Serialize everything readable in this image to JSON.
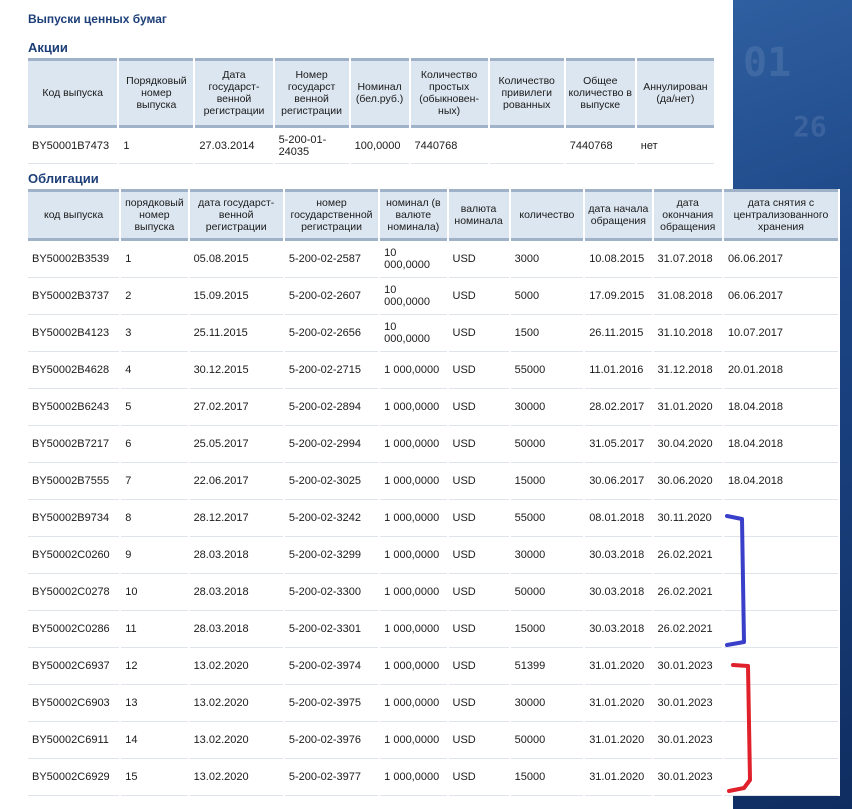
{
  "page": {
    "title": "Выпуски ценных бумаг"
  },
  "stocks": {
    "heading": "Акции",
    "headers": [
      "Код выпуска",
      "Порядковый номер выпуска",
      "Дата государст-венной регистрации",
      "Номер государст венной регистрации",
      "Номинал (бел.руб.)",
      "Количество простых (обыкновен-ных)",
      "Количество привилеги рованных",
      "Общее количество в выпуске",
      "Аннулирован (да/нет)"
    ],
    "rows": [
      [
        "BY50001B7473",
        "1",
        "27.03.2014",
        "5-200-01-24035",
        "100,0000",
        "7440768",
        "",
        "7440768",
        "нет"
      ]
    ]
  },
  "bonds": {
    "heading": "Облигации",
    "headers": [
      "код выпуска",
      "порядковый номер выпуска",
      "дата государст-венной регистрации",
      "номер государственной регистрации",
      "номинал (в валюте номинала)",
      "валюта номинала",
      "количество",
      "дата начала обращения",
      "дата окончания обращения",
      "дата снятия с централизованного хранения"
    ],
    "rows": [
      [
        "BY50002B3539",
        "1",
        "05.08.2015",
        "5-200-02-2587",
        "10 000,0000",
        "USD",
        "3000",
        "10.08.2015",
        "31.07.2018",
        "06.06.2017"
      ],
      [
        "BY50002B3737",
        "2",
        "15.09.2015",
        "5-200-02-2607",
        "10 000,0000",
        "USD",
        "5000",
        "17.09.2015",
        "31.08.2018",
        "06.06.2017"
      ],
      [
        "BY50002B4123",
        "3",
        "25.11.2015",
        "5-200-02-2656",
        "10 000,0000",
        "USD",
        "1500",
        "26.11.2015",
        "31.10.2018",
        "10.07.2017"
      ],
      [
        "BY50002B4628",
        "4",
        "30.12.2015",
        "5-200-02-2715",
        "1 000,0000",
        "USD",
        "55000",
        "11.01.2016",
        "31.12.2018",
        "20.01.2018"
      ],
      [
        "BY50002B6243",
        "5",
        "27.02.2017",
        "5-200-02-2894",
        "1 000,0000",
        "USD",
        "30000",
        "28.02.2017",
        "31.01.2020",
        "18.04.2018"
      ],
      [
        "BY50002B7217",
        "6",
        "25.05.2017",
        "5-200-02-2994",
        "1 000,0000",
        "USD",
        "50000",
        "31.05.2017",
        "30.04.2020",
        "18.04.2018"
      ],
      [
        "BY50002B7555",
        "7",
        "22.06.2017",
        "5-200-02-3025",
        "1 000,0000",
        "USD",
        "15000",
        "30.06.2017",
        "30.06.2020",
        "18.04.2018"
      ],
      [
        "BY50002B9734",
        "8",
        "28.12.2017",
        "5-200-02-3242",
        "1 000,0000",
        "USD",
        "55000",
        "08.01.2018",
        "30.11.2020",
        ""
      ],
      [
        "BY50002C0260",
        "9",
        "28.03.2018",
        "5-200-02-3299",
        "1 000,0000",
        "USD",
        "30000",
        "30.03.2018",
        "26.02.2021",
        ""
      ],
      [
        "BY50002C0278",
        "10",
        "28.03.2018",
        "5-200-02-3300",
        "1 000,0000",
        "USD",
        "50000",
        "30.03.2018",
        "26.02.2021",
        ""
      ],
      [
        "BY50002C0286",
        "11",
        "28.03.2018",
        "5-200-02-3301",
        "1 000,0000",
        "USD",
        "15000",
        "30.03.2018",
        "26.02.2021",
        ""
      ],
      [
        "BY50002C6937",
        "12",
        "13.02.2020",
        "5-200-02-3974",
        "1 000,0000",
        "USD",
        "51399",
        "31.01.2020",
        "30.01.2023",
        ""
      ],
      [
        "BY50002C6903",
        "13",
        "13.02.2020",
        "5-200-02-3975",
        "1 000,0000",
        "USD",
        "30000",
        "31.01.2020",
        "30.01.2023",
        ""
      ],
      [
        "BY50002C6911",
        "14",
        "13.02.2020",
        "5-200-02-3976",
        "1 000,0000",
        "USD",
        "50000",
        "31.01.2020",
        "30.01.2023",
        ""
      ],
      [
        "BY50002C6929",
        "15",
        "13.02.2020",
        "5-200-02-3977",
        "1 000,0000",
        "USD",
        "15000",
        "31.01.2020",
        "30.01.2023",
        ""
      ]
    ]
  },
  "annotations": {
    "blue_bracket_color": "#3a3fc9",
    "red_bracket_color": "#e0202a"
  }
}
